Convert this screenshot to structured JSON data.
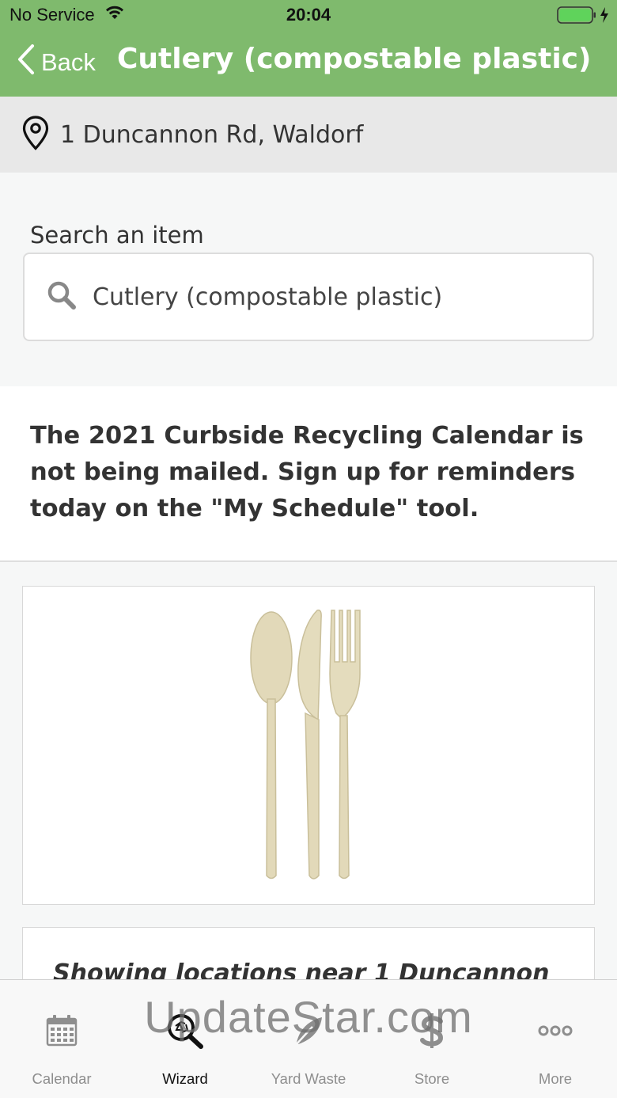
{
  "status_bar": {
    "carrier": "No Service",
    "time": "20:04",
    "wifi_icon": "wifi-icon",
    "battery_icon": "battery-charging-icon"
  },
  "nav": {
    "back_label": "Back",
    "title": "Cutlery (compostable plastic)",
    "color": "#7fba6d"
  },
  "address": {
    "icon": "map-pin-icon",
    "text": "1 Duncannon Rd, Waldorf"
  },
  "search": {
    "label": "Search an item",
    "value": "Cutlery (compostable plastic)",
    "icon": "search-icon"
  },
  "notice": {
    "text": "The 2021 Curbside Recycling Calendar is not being mailed. Sign up for reminders today on the \"My Schedule\" tool."
  },
  "item_image": {
    "icon": "cutlery-image"
  },
  "locations": {
    "text": "Showing locations near 1 Duncannon"
  },
  "tabs": [
    {
      "label": "Calendar",
      "icon": "calendar-icon",
      "active": false
    },
    {
      "label": "Wizard",
      "icon": "wizard-search-icon",
      "active": true
    },
    {
      "label": "Yard Waste",
      "icon": "leaf-icon",
      "active": false
    },
    {
      "label": "Store",
      "icon": "dollar-icon",
      "active": false
    },
    {
      "label": "More",
      "icon": "more-icon",
      "active": false
    }
  ],
  "watermark": {
    "text": "UpdateStar.com"
  }
}
